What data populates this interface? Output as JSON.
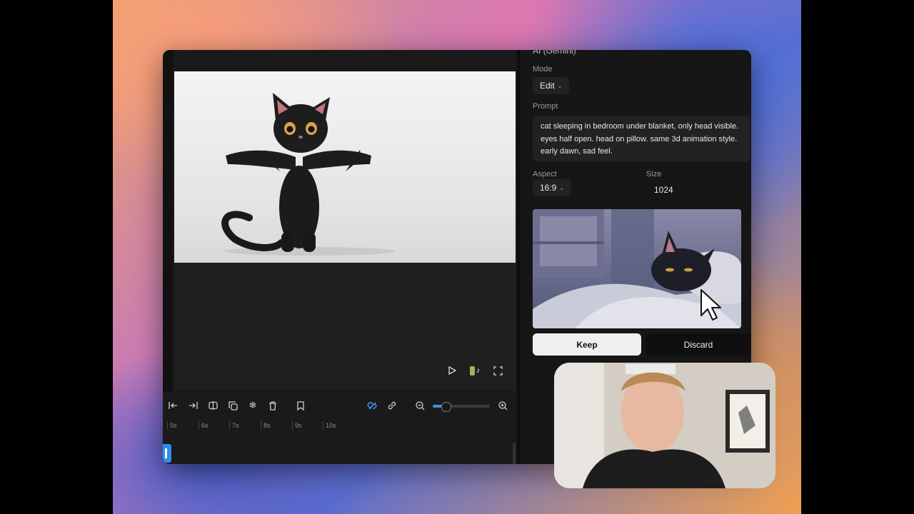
{
  "panel": {
    "section_title": "AI (Gemini)",
    "mode_label": "Mode",
    "mode_value": "Edit",
    "prompt_label": "Prompt",
    "prompt_text": "cat sleeping in bedroom under blanket, only head visible. eyes half open. head on pillow. same 3d animation style. early dawn, sad feel.",
    "aspect_label": "Aspect",
    "aspect_value": "16:9",
    "size_label": "Size",
    "size_value": "1024",
    "keep_label": "Keep",
    "discard_label": "Discard"
  },
  "timeline": {
    "ticks": [
      "5s",
      "6s",
      "7s",
      "8s",
      "9s",
      "10s"
    ],
    "zoom_fraction": 0.22
  },
  "icons": {
    "toolbar": [
      "skip-start-icon",
      "skip-end-icon",
      "split-icon",
      "duplicate-icon",
      "freeze-icon",
      "trash-icon",
      "bookmark-icon",
      "magnet-icon",
      "link-icon",
      "zoom-out-icon",
      "zoom-in-icon"
    ],
    "player": [
      "play-icon",
      "tiktok-icon",
      "fullscreen-icon"
    ]
  },
  "colors": {
    "accent": "#3b8fe0",
    "keep_bg": "#efefef",
    "discard_bg": "#0f0f0f"
  }
}
